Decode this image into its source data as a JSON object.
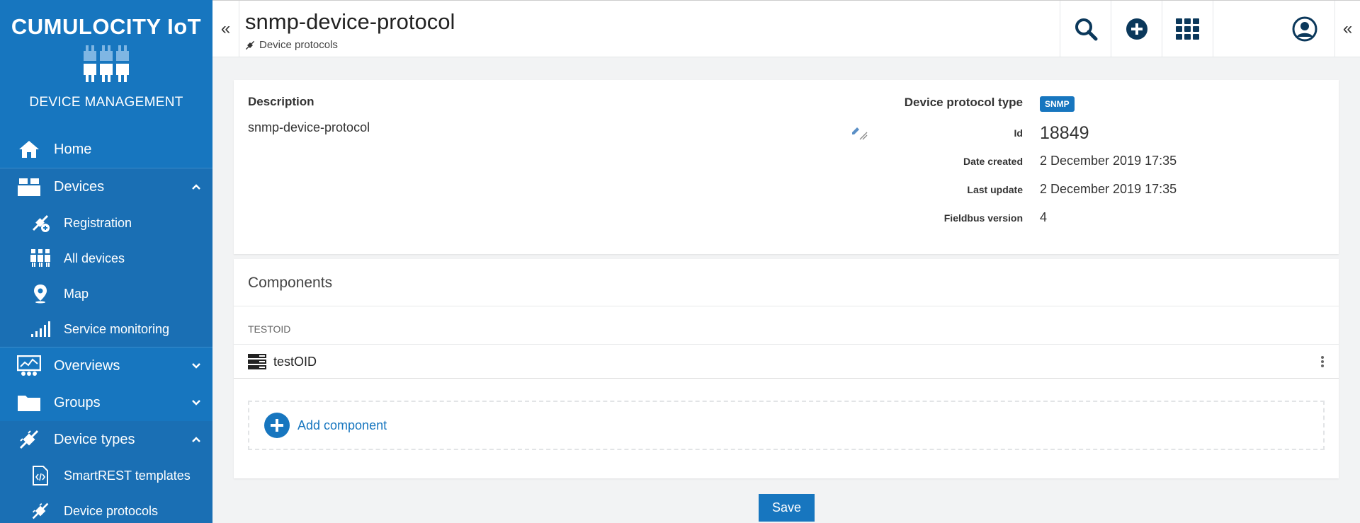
{
  "sidebar": {
    "brand_title": "CUMULOCITY IoT",
    "brand_subtitle": "DEVICE MANAGEMENT",
    "items": {
      "home": "Home",
      "devices": "Devices",
      "registration": "Registration",
      "all_devices": "All devices",
      "map": "Map",
      "service_monitoring": "Service monitoring",
      "overviews": "Overviews",
      "groups": "Groups",
      "device_types": "Device types",
      "smartrest_templates": "SmartREST templates",
      "device_protocols": "Device protocols"
    }
  },
  "header": {
    "title": "snmp-device-protocol",
    "breadcrumb": "Device protocols",
    "icons": [
      "search-icon",
      "add-circle-icon",
      "app-grid-icon",
      "user-circle-icon"
    ]
  },
  "details": {
    "description_label": "Description",
    "description_value": "snmp-device-protocol",
    "protocol_type_label": "Device protocol type",
    "protocol_type_value": "SNMP",
    "id_label": "Id",
    "id_value": "18849",
    "date_created_label": "Date created",
    "date_created_value": "2 December 2019 17:35",
    "last_update_label": "Last update",
    "last_update_value": "2 December 2019 17:35",
    "fieldbus_version_label": "Fieldbus version",
    "fieldbus_version_value": "4"
  },
  "components": {
    "title": "Components",
    "group_label": "TESTOID",
    "rows": [
      {
        "name": "testOID"
      }
    ],
    "add_label": "Add component"
  },
  "actions": {
    "save_label": "Save"
  },
  "colors": {
    "accent": "#1776bf",
    "header_icon": "#0b385b"
  }
}
